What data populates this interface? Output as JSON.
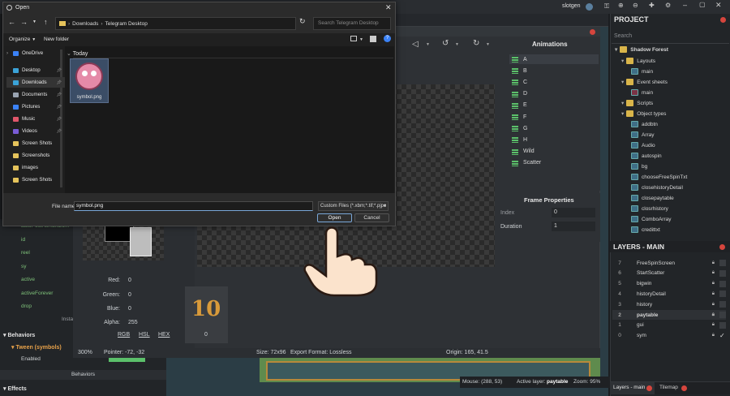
{
  "app": {
    "username": "slotgen"
  },
  "project": {
    "title": "PROJECT",
    "search_placeholder": "Search",
    "root": "Shadow Forest",
    "tree": [
      {
        "label": "Layouts",
        "kind": "folder",
        "depth": 1
      },
      {
        "label": "main",
        "kind": "layout",
        "depth": 2
      },
      {
        "label": "Event sheets",
        "kind": "folder",
        "depth": 1
      },
      {
        "label": "main",
        "kind": "eventsheet",
        "depth": 2
      },
      {
        "label": "Scripts",
        "kind": "folder",
        "depth": 1
      },
      {
        "label": "Object types",
        "kind": "folder",
        "depth": 1
      },
      {
        "label": "addbtn",
        "kind": "obj",
        "depth": 2
      },
      {
        "label": "Array",
        "kind": "obj",
        "depth": 2
      },
      {
        "label": "Audio",
        "kind": "obj",
        "depth": 2
      },
      {
        "label": "autospin",
        "kind": "obj",
        "depth": 2
      },
      {
        "label": "bg",
        "kind": "obj",
        "depth": 2
      },
      {
        "label": "chooseFreeSpinTxt",
        "kind": "obj",
        "depth": 2
      },
      {
        "label": "closehistoryDetail",
        "kind": "obj",
        "depth": 2
      },
      {
        "label": "closepaytable",
        "kind": "obj",
        "depth": 2
      },
      {
        "label": "closrhistory",
        "kind": "obj",
        "depth": 2
      },
      {
        "label": "ComboArray",
        "kind": "obj",
        "depth": 2
      },
      {
        "label": "credittxt",
        "kind": "obj",
        "depth": 2
      }
    ]
  },
  "layers": {
    "title": "LAYERS - MAIN",
    "items": [
      {
        "num": "7",
        "name": "FreeSpinScreen"
      },
      {
        "num": "6",
        "name": "StartScatter"
      },
      {
        "num": "5",
        "name": "bigwin"
      },
      {
        "num": "4",
        "name": "historyDetail"
      },
      {
        "num": "3",
        "name": "history"
      },
      {
        "num": "2",
        "name": "paytable"
      },
      {
        "num": "1",
        "name": "gui"
      },
      {
        "num": "0",
        "name": "sym"
      }
    ],
    "tabs": [
      "Layers - main",
      "Tilemap"
    ]
  },
  "animations": {
    "title": "Animations",
    "items": [
      "A",
      "B",
      "C",
      "D",
      "E",
      "F",
      "G",
      "H",
      "Wild",
      "Scatter"
    ]
  },
  "frame_properties": {
    "title": "Frame Properties",
    "index_label": "Index",
    "index_value": "0",
    "duration_label": "Duration",
    "duration_value": "1"
  },
  "color": {
    "red_label": "Red:",
    "red": "0",
    "green_label": "Green:",
    "green": "0",
    "blue_label": "Blue:",
    "blue": "0",
    "alpha_label": "Alpha:",
    "alpha": "255",
    "modes": [
      "RGB",
      "HSL",
      "HEX"
    ]
  },
  "frame_thumb_index": "0",
  "status": {
    "zoom": "300%",
    "pointer": "Pointer: -72, -32",
    "size": "Size: 72x96",
    "export": "Export Format: Lossless",
    "origin": "Origin: 165, 41.5",
    "mouse": "Mouse: (288, 53)",
    "active_layer_label": "Active layer:",
    "active_layer": "paytable",
    "zoom_main": "Zoom: 95%"
  },
  "left_props": {
    "items": [
      "id",
      "reel",
      "sy",
      "active",
      "activeForever",
      "drop"
    ],
    "truncated_top": "autoPoolAsRunGo...",
    "instance_label": "Insta",
    "behaviors_header": "Behaviors",
    "tween": "Tween (symbols)",
    "enabled_label": "Enabled",
    "enabled_value": "true",
    "behaviors_button": "Behaviors",
    "effects_header": "Effects"
  },
  "dialog": {
    "title": "Open",
    "breadcrumb": [
      "Downloads",
      "Telegram Desktop"
    ],
    "search_placeholder": "Search Telegram Desktop",
    "organize": "Organize",
    "new_folder": "New folder",
    "nav": [
      {
        "label": "OneDrive",
        "icon": "cloud-icon",
        "pinned": false
      },
      {
        "label": "Desktop",
        "icon": "desktop-icon",
        "pinned": true
      },
      {
        "label": "Downloads",
        "icon": "download-icon",
        "pinned": true
      },
      {
        "label": "Documents",
        "icon": "document-icon",
        "pinned": true
      },
      {
        "label": "Pictures",
        "icon": "picture-icon",
        "pinned": true
      },
      {
        "label": "Music",
        "icon": "music-icon",
        "pinned": true
      },
      {
        "label": "Videos",
        "icon": "video-icon",
        "pinned": true
      },
      {
        "label": "Screen Shots",
        "icon": "folder-icon",
        "pinned": false
      },
      {
        "label": "Screenshots",
        "icon": "folder-icon",
        "pinned": false
      },
      {
        "label": "images",
        "icon": "folder-icon",
        "pinned": false
      },
      {
        "label": "Screen Shots",
        "icon": "folder-icon",
        "pinned": false
      }
    ],
    "group_today": "Today",
    "file_name": "symbol.png",
    "file_name_label": "File name:",
    "file_name_value": "symbol.png",
    "file_type": "Custom Files (*.xbm;*.tif;*.pjpe",
    "open_label": "Open",
    "cancel_label": "Cancel"
  },
  "colors": {
    "accent_red": "#d6453d",
    "anim_green": "#5bc06a",
    "behavior_orange": "#e8a24a",
    "prop_green": "#7fc27a"
  }
}
